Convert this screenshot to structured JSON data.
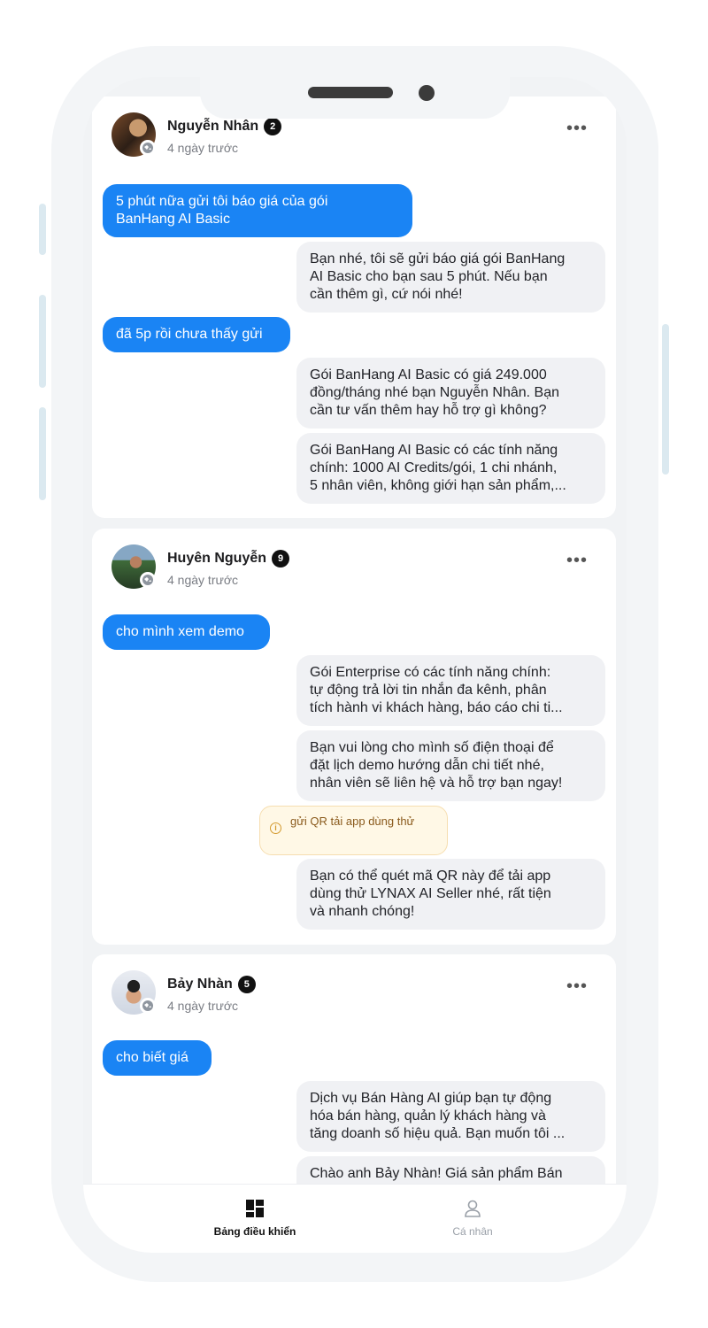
{
  "conversations": [
    {
      "name": "Nguyễn Nhân",
      "count": "2",
      "time": "4 ngày trước",
      "messages": [
        "5 phút nữa gửi tôi báo giá của gói\nBanHang AI Basic",
        "Bạn nhé, tôi sẽ gửi báo giá gói BanHang\nAI Basic cho bạn sau 5 phút. Nếu bạn\ncần thêm gì, cứ nói nhé!",
        "đã 5p rồi chưa thấy gửi",
        "Gói BanHang AI Basic có giá 249.000\nđồng/tháng nhé bạn Nguyễn Nhân. Bạn\ncần tư vấn thêm hay hỗ trợ gì không?",
        "Gói BanHang AI Basic có các tính năng\nchính: 1000 AI Credits/gói, 1 chi nhánh,\n5 nhân viên, không giới hạn sản phẩm,..."
      ]
    },
    {
      "name": "Huyên Nguyễn",
      "count": "9",
      "time": "4 ngày trước",
      "messages": [
        "cho mình xem demo",
        "Gói Enterprise có các tính năng chính:\ntự động trả lời tin nhắn đa kênh, phân\ntích hành vi khách hàng, báo cáo chi ti...",
        "Bạn vui lòng cho mình số điện thoại để\nđặt lịch demo hướng dẫn chi tiết nhé,\nnhân viên sẽ liên hệ và hỗ trợ bạn ngay!",
        "Bạn có thể quét mã QR này để tải app\ndùng thử LYNAX AI Seller nhé, rất tiện\nvà nhanh chóng!"
      ],
      "note": "gửi QR tải app dùng thử"
    },
    {
      "name": "Bảy Nhàn",
      "count": "5",
      "time": "4 ngày trước",
      "messages": [
        "cho biết giá",
        "Dịch vụ Bán Hàng AI giúp bạn tự động\nhóa bán hàng, quản lý khách hàng và\ntăng doanh số hiệu quả. Bạn muốn tôi ...",
        "Chào anh Bảy Nhàn! Giá sản phẩm Bán"
      ]
    }
  ],
  "more_label": "•••",
  "nav": {
    "dashboard_label": "Bảng điều khiển",
    "profile_label": "Cá nhân"
  },
  "icons": {
    "globe": "globe-icon",
    "more": "more-icon",
    "dashboard": "dashboard-icon",
    "profile": "user-icon",
    "info": "info-icon"
  },
  "colors": {
    "accent": "#1a84f4",
    "incoming_bubble_text": "#ffffff",
    "outgoing_bubble": "#f0f1f4",
    "note_bg": "#fff8e6"
  }
}
